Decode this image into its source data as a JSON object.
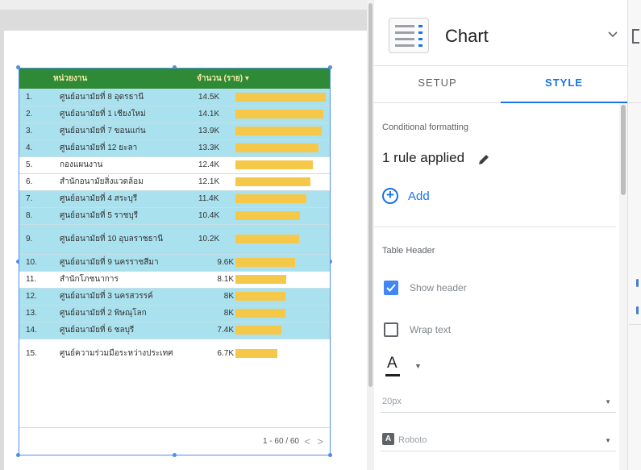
{
  "table": {
    "headers": {
      "name": "หน่วยงาน",
      "count": "จำนวน (ราย) ▾"
    },
    "max_value": 14.5,
    "rows": [
      {
        "idx": "1.",
        "name": "ศูนย์อนามัยที่ 8 อุดรธานี",
        "value_label": "14.5K",
        "value": 14.5,
        "highlight": true,
        "tall": false
      },
      {
        "idx": "2.",
        "name": "ศูนย์อนามัยที่ 1 เชียงใหม่",
        "value_label": "14.1K",
        "value": 14.1,
        "highlight": true,
        "tall": false
      },
      {
        "idx": "3.",
        "name": "ศูนย์อนามัยที่ 7 ขอนแก่น",
        "value_label": "13.9K",
        "value": 13.9,
        "highlight": true,
        "tall": false
      },
      {
        "idx": "4.",
        "name": "ศูนย์อนามัยที่ 12 ยะลา",
        "value_label": "13.3K",
        "value": 13.3,
        "highlight": true,
        "tall": false
      },
      {
        "idx": "5.",
        "name": "กองแผนงาน",
        "value_label": "12.4K",
        "value": 12.4,
        "highlight": false,
        "tall": false
      },
      {
        "idx": "6.",
        "name": "สำนักอนามัยสิ่งแวดล้อม",
        "value_label": "12.1K",
        "value": 12.1,
        "highlight": false,
        "tall": false
      },
      {
        "idx": "7.",
        "name": "ศูนย์อนามัยที่ 4 สระบุรี",
        "value_label": "11.4K",
        "value": 11.4,
        "highlight": true,
        "tall": false
      },
      {
        "idx": "8.",
        "name": "ศูนย์อนามัยที่ 5 ราชบุรี",
        "value_label": "10.4K",
        "value": 10.4,
        "highlight": true,
        "tall": false
      },
      {
        "idx": "9.",
        "name": "ศูนย์อนามัยที่ 10 อุบลราชธานี",
        "value_label": "10.2K",
        "value": 10.2,
        "highlight": true,
        "tall": true
      },
      {
        "idx": "10.",
        "name": "ศูนย์อนามัยที่ 9 นครราชสีมา",
        "value_label": "9.6K",
        "value": 9.6,
        "highlight": true,
        "tall": false
      },
      {
        "idx": "11.",
        "name": "สำนักโภชนาการ",
        "value_label": "8.1K",
        "value": 8.1,
        "highlight": false,
        "tall": false
      },
      {
        "idx": "12.",
        "name": "ศูนย์อนามัยที่ 3 นครสวรรค์",
        "value_label": "8K",
        "value": 8.0,
        "highlight": true,
        "tall": false
      },
      {
        "idx": "13.",
        "name": "ศูนย์อนามัยที่ 2 พิษณุโลก",
        "value_label": "8K",
        "value": 8.0,
        "highlight": true,
        "tall": false
      },
      {
        "idx": "14.",
        "name": "ศูนย์อนามัยที่ 6 ชลบุรี",
        "value_label": "7.4K",
        "value": 7.4,
        "highlight": true,
        "tall": false
      },
      {
        "idx": "15.",
        "name": "ศูนย์ความร่วมมือระหว่างประเทศ",
        "value_label": "6.7K",
        "value": 6.7,
        "highlight": false,
        "tall": true
      }
    ],
    "pager": {
      "text": "1 - 60 / 60",
      "prev": "<",
      "next": ">"
    }
  },
  "panel": {
    "title": "Chart",
    "tabs": {
      "setup": "SETUP",
      "style": "STYLE"
    },
    "conditional_formatting": {
      "label": "Conditional formatting",
      "rules": "1 rule applied",
      "add_label": "Add"
    },
    "table_header": {
      "label": "Table Header",
      "show_header": "Show header",
      "show_header_checked": true,
      "wrap_text": "Wrap text",
      "wrap_text_checked": false,
      "font_color_letter": "A",
      "font_size": "20px",
      "font_family": "Roboto",
      "font_family_icon": "A"
    }
  },
  "colors": {
    "header_bg": "#2e8a36",
    "highlight_row": "#a9e1ee",
    "bar": "#f5c84a",
    "accent": "#1a73e8"
  },
  "icons": [
    "chart-type-icon",
    "chevron-down-icon",
    "pencil-icon",
    "add-circle-icon",
    "checkbox-checked-icon",
    "checkbox-empty-icon",
    "font-color-icon",
    "font-family-icon",
    "dropdown-caret-icon"
  ]
}
